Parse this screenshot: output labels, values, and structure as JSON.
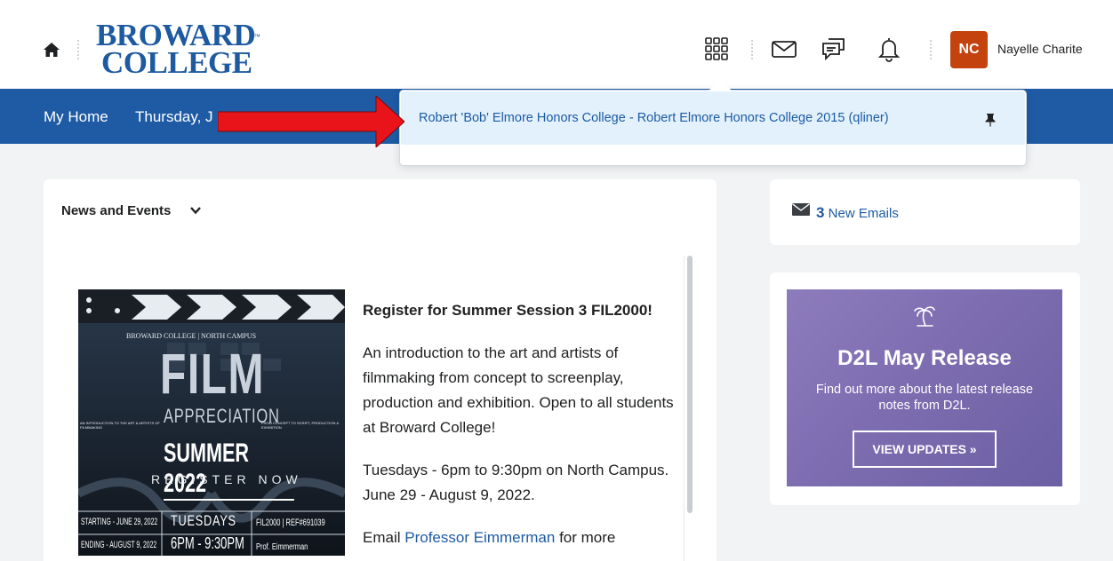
{
  "header": {
    "logo_line1": "BROWARD",
    "logo_line2": "COLLEGE",
    "logo_tm": "™",
    "avatar_initials": "NC",
    "user_name": "Nayelle Charite",
    "icons": [
      "home-icon",
      "waffle-grid-icon",
      "mail-icon",
      "chat-icon",
      "bell-icon"
    ]
  },
  "navbar": {
    "home": "My Home",
    "date_partial": "Thursday, J"
  },
  "dropdown": {
    "item": "Robert 'Bob' Elmore Honors College - Robert Elmore Honors College 2015 (qliner)"
  },
  "news": {
    "title": "News and Events",
    "headline": "Register for Summer Session 3 FIL2000!",
    "para1": "An introduction to the art and artists of filmmaking from concept to screenplay, production and exhibition. Open to all students at Broward College!",
    "para2": "Tuesdays - 6pm to 9:30pm on North Campus. June 29 - August 9, 2022.",
    "para3_prefix": "Email ",
    "para3_link": "Professor Eimmerman",
    "para3_suffix": " for more",
    "poster": {
      "top": "BROWARD COLLEGE | NORTH CAMPUS",
      "film": "FILM",
      "appreciation": "APPRECIATION",
      "side_left": "AN INTRODUCTION TO THE ART & ARTISTS OF FILMMAKING",
      "side_right": "FROM CONCEPT TO SCRIPT, PRODUCTION & EXHIBITION",
      "summer": "SUMMER 2022",
      "register": "REGISTER NOW",
      "starting": "STARTING - JUNE 29, 2022",
      "ending": "ENDING - AUGUST 9, 2022",
      "tuesdays": "TUESDAYS",
      "time": "6PM - 9:30PM",
      "course": "FIL2000 | REF#691039",
      "prof": "Prof. Eimmerman"
    }
  },
  "emails": {
    "count": "3",
    "label": "New Emails"
  },
  "d2l": {
    "title": "D2L May Release",
    "subtitle": "Find out more about the latest release notes from D2L.",
    "button": "VIEW UPDATES »"
  },
  "colors": {
    "brand_blue": "#1e5ba4",
    "avatar_orange": "#c4420e",
    "highlight": "#e2f1fb",
    "arrow_red": "#e8141a",
    "d2l_purple": "#7a6aae"
  }
}
